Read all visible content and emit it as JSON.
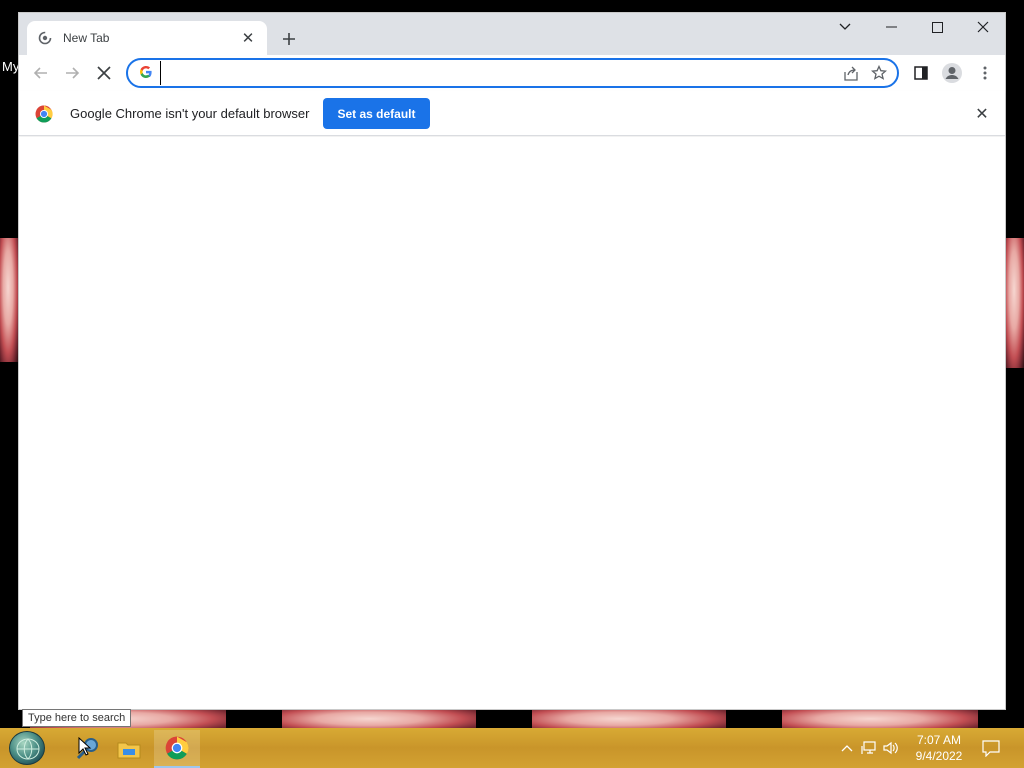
{
  "desktop": {
    "label_fragment": "My"
  },
  "browser": {
    "tab": {
      "title": "New Tab",
      "favicon": "chrome-loading-icon",
      "close": "close-icon"
    },
    "new_tab": "plus-icon",
    "window_controls": [
      "chevron-down-icon",
      "minimize-icon",
      "maximize-icon",
      "close-icon"
    ],
    "toolbar": {
      "back": "arrow-left-icon",
      "forward": "arrow-right-icon",
      "stop": "stop-icon",
      "omnibox": {
        "value": "",
        "provider_icon": "google-g-icon"
      },
      "share": "share-icon",
      "bookmark": "star-icon",
      "side_panel": "side-panel-icon",
      "profile": "avatar-icon",
      "menu": "more-vert-icon"
    },
    "infobar": {
      "message": "Google Chrome isn't your default browser",
      "button_label": "Set as default"
    },
    "accent_color": "#1a73e8"
  },
  "taskbar": {
    "tooltip": "Type here to search",
    "clock": {
      "time": "7:07 AM",
      "date": "9/4/2022"
    },
    "pinned": [
      "search-icon",
      "file-explorer-icon",
      "chrome-icon"
    ],
    "tray": [
      "chevron-up-icon",
      "network-icon",
      "volume-icon",
      "notification-icon"
    ],
    "color": "#c9952a"
  }
}
